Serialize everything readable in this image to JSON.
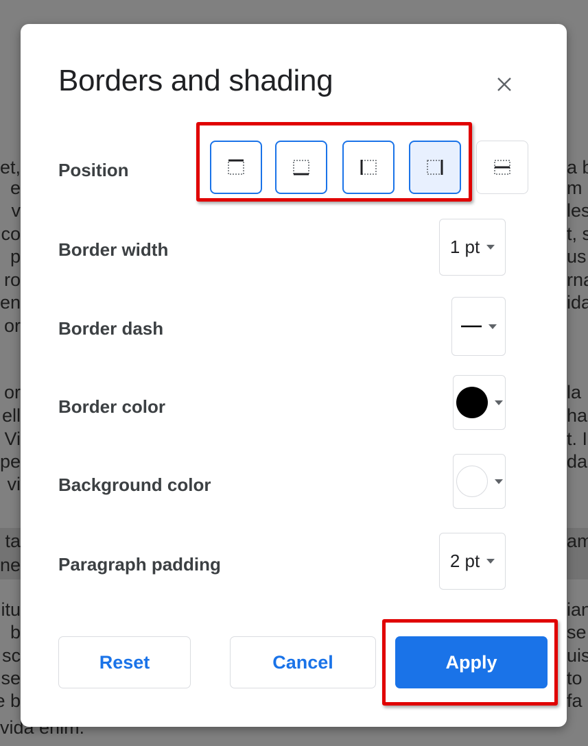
{
  "background_document": {
    "left_fragments": [
      "et,",
      "e",
      "v",
      "co",
      "p",
      "ro",
      "en",
      "or",
      "or",
      "ell",
      "Vi",
      "pe",
      "vi",
      "ta",
      "ne",
      "itu",
      "b",
      "sc",
      "se",
      "e b",
      "vida enim."
    ],
    "right_fragments": [
      "a b",
      "m",
      "les",
      "t, s",
      "us",
      "rna",
      "ida",
      "la",
      "hal",
      "t. I",
      "da",
      "am",
      "ian",
      "se",
      "uis",
      "to",
      "fa"
    ]
  },
  "dialog": {
    "title": "Borders and shading",
    "close_icon": "close-icon",
    "position": {
      "label": "Position",
      "options": [
        {
          "name": "top-border",
          "icon": "border-top-icon"
        },
        {
          "name": "bottom-border",
          "icon": "border-bottom-icon"
        },
        {
          "name": "left-border",
          "icon": "border-left-icon"
        },
        {
          "name": "right-border",
          "icon": "border-right-icon",
          "selected": true
        },
        {
          "name": "between-border",
          "icon": "border-between-icon"
        }
      ]
    },
    "border_width": {
      "label": "Border width",
      "value": "1 pt"
    },
    "border_dash": {
      "label": "Border dash",
      "value_icon": "solid-line-icon"
    },
    "border_color": {
      "label": "Border color",
      "value_color": "#000000"
    },
    "background_color": {
      "label": "Background color",
      "value_color": "#ffffff"
    },
    "paragraph_padding": {
      "label": "Paragraph padding",
      "value": "2 pt"
    },
    "buttons": {
      "reset": "Reset",
      "cancel": "Cancel",
      "apply": "Apply"
    }
  },
  "colors": {
    "accent": "#1a73e8",
    "highlight": "#e00000",
    "selected_bg": "#e8f0fe"
  }
}
